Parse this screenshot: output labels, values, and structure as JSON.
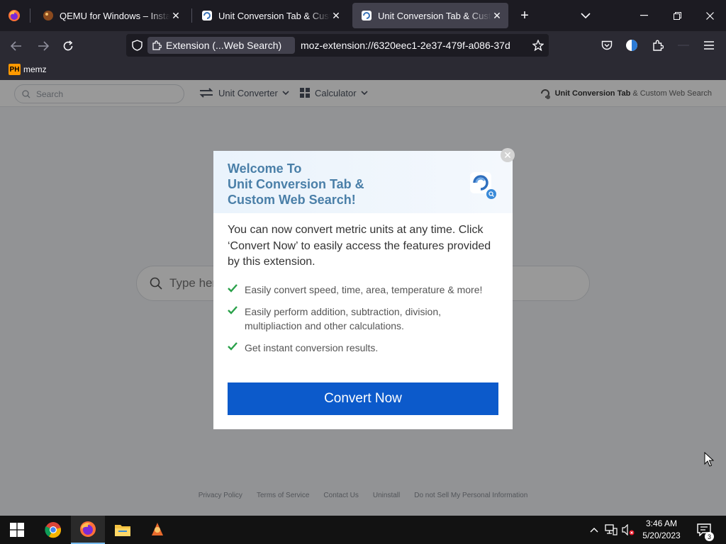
{
  "tabs": [
    {
      "title": "QEMU for Windows – Installe",
      "close": "✕"
    },
    {
      "title": "Unit Conversion Tab & Custom",
      "close": "✕"
    },
    {
      "title": "Unit Conversion Tab & Custom",
      "close": "✕"
    }
  ],
  "tabbar": {
    "new_tab": "+",
    "list_tabs": "⌄",
    "minimize": "—",
    "restore": "❐",
    "close": "✕"
  },
  "navbar": {
    "extension_label": "Extension (...Web Search)",
    "url": "moz-extension://6320eec1-2e37-479f-a086-37d"
  },
  "bookmarks": [
    {
      "badge": "PH",
      "label": "memz"
    }
  ],
  "ext_toolbar": {
    "search_placeholder": "Search",
    "unit_converter": "Unit Converter",
    "calculator": "Calculator",
    "brand_bold": "Unit Conversion Tab",
    "brand_rest": "& Custom Web Search"
  },
  "main_search": {
    "placeholder": "Type her"
  },
  "footer_links": [
    "Privacy Policy",
    "Terms of Service",
    "Contact Us",
    "Uninstall",
    "Do not Sell My Personal Information"
  ],
  "modal": {
    "title": "Welcome To\nUnit Conversion Tab &\nCustom Web Search!",
    "description": "You can now convert metric units at any time. Click ‘Convert Now’ to easily access the features provided by this extension.",
    "features": [
      "Easily convert speed, time, area, temperature & more!",
      "Easily perform addition, subtraction, division, multipliaction and other calculations.",
      "Get instant conversion results."
    ],
    "button": "Convert Now",
    "close": "✕"
  },
  "taskbar": {
    "time": "3:46 AM",
    "date": "5/20/2023",
    "notifications": "3"
  },
  "colors": {
    "accent_button": "#0c5acb",
    "modal_title": "#4a7fa8",
    "check": "#2aa14a"
  }
}
